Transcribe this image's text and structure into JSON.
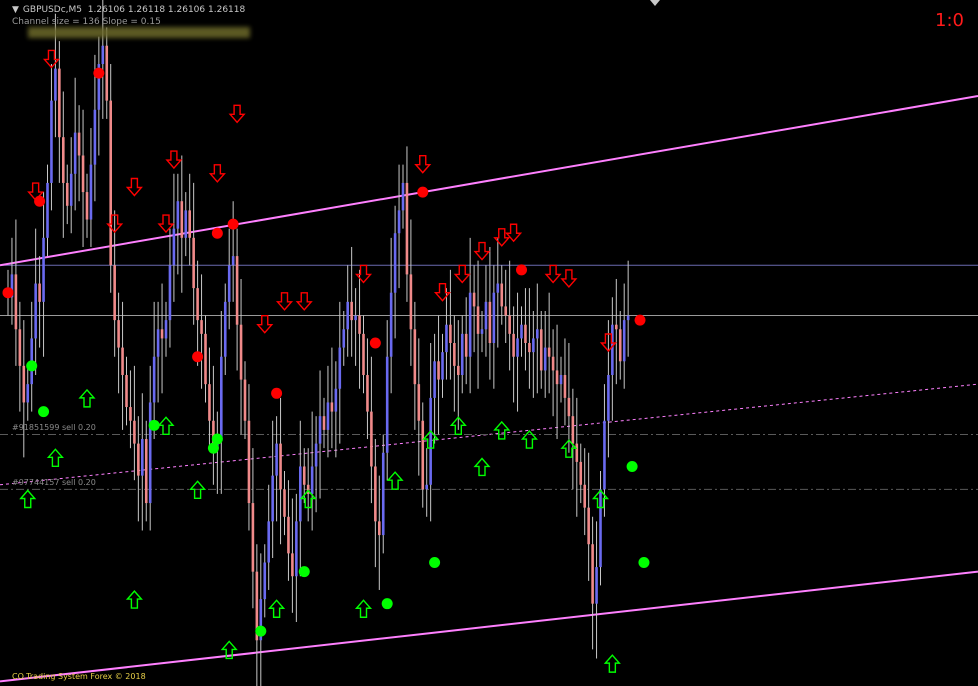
{
  "header": {
    "symbol": "GBPUSDc,M5",
    "ohlc": "1.26106 1.26118 1.26106 1.26118",
    "channel_info": "Channel size = 136 Slope = 0.15"
  },
  "score": "1:0",
  "footer": {
    "text": "CO.Trading System Forex © 2018"
  },
  "orders": [
    {
      "label": "#91851599 sell 0.20",
      "price": 1.2575
    },
    {
      "label": "#97744157 sell 0.20",
      "price": 1.2563
    }
  ],
  "colors": {
    "background": "#000000",
    "bull_body": "#6a6af0",
    "bear_body": "#f08a8a",
    "wick": "#c8c8c8",
    "channel": "#ff80ff",
    "signal_up": "#00ff00",
    "signal_down": "#ff0000",
    "score": "#ff1a1a",
    "footer": "#e8d048"
  },
  "chart_data": {
    "type": "candlestick",
    "series_name": "GBPUSDc,M5",
    "grid": false,
    "ylim": [
      1.252,
      1.267
    ],
    "horizontal_levels": [
      1.2612,
      1.2601
    ],
    "channel": {
      "upper": {
        "start": 1.2612,
        "end": 1.2649
      },
      "lower": {
        "start": 1.2521,
        "end": 1.2545
      },
      "middle": {
        "start": 1.2564,
        "end": 1.2586
      }
    },
    "closes": [
      1.2605,
      1.261,
      1.2598,
      1.259,
      1.2582,
      1.2586,
      1.2596,
      1.2608,
      1.2604,
      1.2618,
      1.263,
      1.2648,
      1.2655,
      1.264,
      1.263,
      1.2625,
      1.2632,
      1.2641,
      1.2636,
      1.2628,
      1.2622,
      1.2634,
      1.2646,
      1.2656,
      1.266,
      1.2648,
      1.2612,
      1.26,
      1.2594,
      1.2588,
      1.2581,
      1.2578,
      1.2573,
      1.2566,
      1.2574,
      1.256,
      1.2582,
      1.2592,
      1.2598,
      1.2596,
      1.26,
      1.2612,
      1.262,
      1.2626,
      1.2618,
      1.2624,
      1.2618,
      1.2607,
      1.26,
      1.2597,
      1.2586,
      1.2578,
      1.2572,
      1.2574,
      1.2592,
      1.2604,
      1.2612,
      1.2614,
      1.2599,
      1.2587,
      1.2578,
      1.256,
      1.2545,
      1.253,
      1.2539,
      1.2547,
      1.2556,
      1.2566,
      1.2573,
      1.2563,
      1.2557,
      1.2549,
      1.2544,
      1.2556,
      1.2568,
      1.2564,
      1.2562,
      1.2568,
      1.2573,
      1.2579,
      1.2576,
      1.2582,
      1.258,
      1.2585,
      1.2594,
      1.2598,
      1.2604,
      1.26,
      1.2601,
      1.2597,
      1.2588,
      1.258,
      1.2568,
      1.2556,
      1.2553,
      1.2571,
      1.2592,
      1.2606,
      1.2619,
      1.2624,
      1.263,
      1.261,
      1.2598,
      1.2586,
      1.2578,
      1.2563,
      1.2564,
      1.2583,
      1.2591,
      1.2587,
      1.2593,
      1.2599,
      1.2595,
      1.259,
      1.2588,
      1.2597,
      1.2592,
      1.2606,
      1.2603,
      1.2597,
      1.2598,
      1.2604,
      1.2595,
      1.2606,
      1.2608,
      1.2603,
      1.2601,
      1.2597,
      1.2592,
      1.2596,
      1.2599,
      1.2595,
      1.2593,
      1.2596,
      1.2598,
      1.2589,
      1.2594,
      1.2592,
      1.2589,
      1.2586,
      1.2588,
      1.2583,
      1.2579,
      1.2573,
      1.2569,
      1.2564,
      1.2559,
      1.2551,
      1.2538,
      1.2546,
      1.2563,
      1.2578,
      1.2588,
      1.2599,
      1.2598,
      1.2591,
      1.26,
      1.2601
    ],
    "signals_up": [
      [
        5,
        1.2561
      ],
      [
        12,
        1.257
      ],
      [
        20,
        1.2583
      ],
      [
        32,
        1.2539
      ],
      [
        40,
        1.2577
      ],
      [
        48,
        1.2563
      ],
      [
        56,
        1.2528
      ],
      [
        68,
        1.2537
      ],
      [
        76,
        1.2561
      ],
      [
        90,
        1.2537
      ],
      [
        98,
        1.2565
      ],
      [
        107,
        1.2574
      ],
      [
        114,
        1.2577
      ],
      [
        120,
        1.2568
      ],
      [
        125,
        1.2576
      ],
      [
        132,
        1.2574
      ],
      [
        142,
        1.2572
      ],
      [
        150,
        1.2561
      ],
      [
        153,
        1.2525
      ]
    ],
    "signals_down": [
      [
        7,
        1.2628
      ],
      [
        11,
        1.2657
      ],
      [
        27,
        1.2621
      ],
      [
        32,
        1.2629
      ],
      [
        40,
        1.2621
      ],
      [
        42,
        1.2635
      ],
      [
        53,
        1.2632
      ],
      [
        58,
        1.2645
      ],
      [
        65,
        1.2599
      ],
      [
        70,
        1.2604
      ],
      [
        75,
        1.2604
      ],
      [
        90,
        1.261
      ],
      [
        105,
        1.2634
      ],
      [
        110,
        1.2606
      ],
      [
        115,
        1.261
      ],
      [
        120,
        1.2615
      ],
      [
        125,
        1.2618
      ],
      [
        128,
        1.2619
      ],
      [
        138,
        1.261
      ],
      [
        142,
        1.2609
      ],
      [
        152,
        1.2595
      ]
    ],
    "dots_red": [
      [
        0,
        1.2606
      ],
      [
        8,
        1.2626
      ],
      [
        23,
        1.2654
      ],
      [
        48,
        1.2592
      ],
      [
        53,
        1.2619
      ],
      [
        57,
        1.2621
      ],
      [
        68,
        1.2584
      ],
      [
        93,
        1.2595
      ],
      [
        105,
        1.2628
      ],
      [
        130,
        1.2611
      ],
      [
        160,
        1.26
      ]
    ],
    "dots_green": [
      [
        6,
        1.259
      ],
      [
        9,
        1.258
      ],
      [
        37,
        1.2577
      ],
      [
        52,
        1.2572
      ],
      [
        53,
        1.2574
      ],
      [
        64,
        1.2532
      ],
      [
        75,
        1.2545
      ],
      [
        96,
        1.2538
      ],
      [
        108,
        1.2547
      ],
      [
        158,
        1.2568
      ],
      [
        161,
        1.2547
      ]
    ]
  }
}
